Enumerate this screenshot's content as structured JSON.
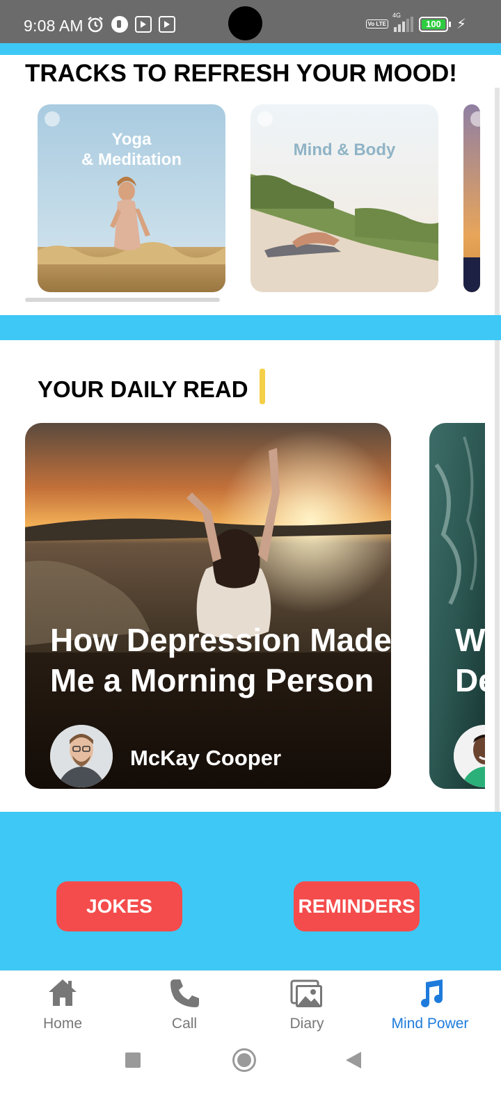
{
  "status_bar": {
    "time": "9:08 AM",
    "battery": "100",
    "network": "4G",
    "volte": "Vo LTE"
  },
  "tracks": {
    "title": "TRACKS TO REFRESH YOUR MOOD!",
    "cards": [
      {
        "title_line1": "Yoga",
        "title_line2": "& Meditation"
      },
      {
        "title_line1": "Mind & Body"
      }
    ]
  },
  "daily_read": {
    "title": "YOUR DAILY READ",
    "articles": [
      {
        "title_line1": "How Depression Made",
        "title_line2": "Me a Morning Person",
        "author": "McKay Cooper"
      },
      {
        "title_line1": "Wh",
        "title_line2": "De"
      }
    ]
  },
  "actions": {
    "jokes": "JOKES",
    "reminders": "REMINDERS"
  },
  "nav": {
    "items": [
      {
        "label": "Home",
        "icon": "home-icon"
      },
      {
        "label": "Call",
        "icon": "phone-icon"
      },
      {
        "label": "Diary",
        "icon": "gallery-icon"
      },
      {
        "label": "Mind Power",
        "icon": "music-note-icon",
        "active": true
      }
    ]
  },
  "colors": {
    "accent_blue": "#3ec8f5",
    "button_red": "#f44c4c",
    "nav_active": "#1e7bdc",
    "nav_inactive": "#777777",
    "cursor_yellow": "#f4cf48"
  }
}
